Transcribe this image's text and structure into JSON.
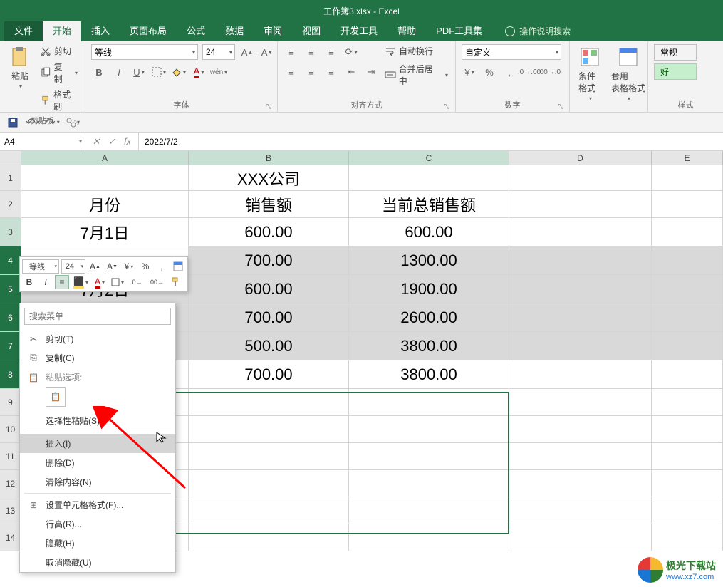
{
  "title": "工作簿3.xlsx - Excel",
  "tabs": {
    "file": "文件",
    "home": "开始",
    "insert": "插入",
    "layout": "页面布局",
    "formulas": "公式",
    "data": "数据",
    "review": "审阅",
    "view": "视图",
    "dev": "开发工具",
    "help": "帮助",
    "pdf": "PDF工具集",
    "tell": "操作说明搜索"
  },
  "ribbon": {
    "clipboard": {
      "label": "剪贴板",
      "paste": "粘贴",
      "cut": "剪切",
      "copy": "复制",
      "painter": "格式刷"
    },
    "font": {
      "label": "字体",
      "name": "等线",
      "size": "24"
    },
    "align": {
      "label": "对齐方式",
      "wrap": "自动换行",
      "merge": "合并后居中"
    },
    "number": {
      "label": "数字",
      "format": "自定义"
    },
    "styles": {
      "label": "样式",
      "cond": "条件格式",
      "tablefmt": "套用\n表格格式",
      "normal": "常规",
      "good": "好"
    }
  },
  "namebox": "A4",
  "formula": "2022/7/2",
  "cols": [
    "A",
    "B",
    "C",
    "D",
    "E"
  ],
  "rows": [
    "1",
    "2",
    "3",
    "4",
    "5",
    "6",
    "7",
    "8",
    "9",
    "10",
    "11",
    "12",
    "13",
    "14"
  ],
  "cells": {
    "b1": "XXX公司",
    "a2": "月份",
    "b2": "销售额",
    "c2": "当前总销售额",
    "a3": "7月1日",
    "b3": "600.00",
    "c3": "600.00",
    "b4": "700.00",
    "c4": "1300.00",
    "a5": "7月2日",
    "b5": "600.00",
    "c5": "1900.00",
    "b6": "700.00",
    "c6": "2600.00",
    "b7": "500.00",
    "c7": "3800.00",
    "b8": "700.00",
    "c8": "3800.00"
  },
  "minitoolbar": {
    "font": "等线",
    "size": "24"
  },
  "ctx": {
    "search_ph": "搜索菜单",
    "cut": "剪切(T)",
    "copy": "复制(C)",
    "paste_opts": "粘贴选项:",
    "paste_special": "选择性粘贴(S)...",
    "insert": "插入(I)",
    "delete": "删除(D)",
    "clear": "清除内容(N)",
    "format": "设置单元格格式(F)...",
    "rowh": "行高(R)...",
    "hide": "隐藏(H)",
    "unhide": "取消隐藏(U)"
  },
  "watermark": {
    "name": "极光下载站",
    "url": "www.xz7.com"
  }
}
